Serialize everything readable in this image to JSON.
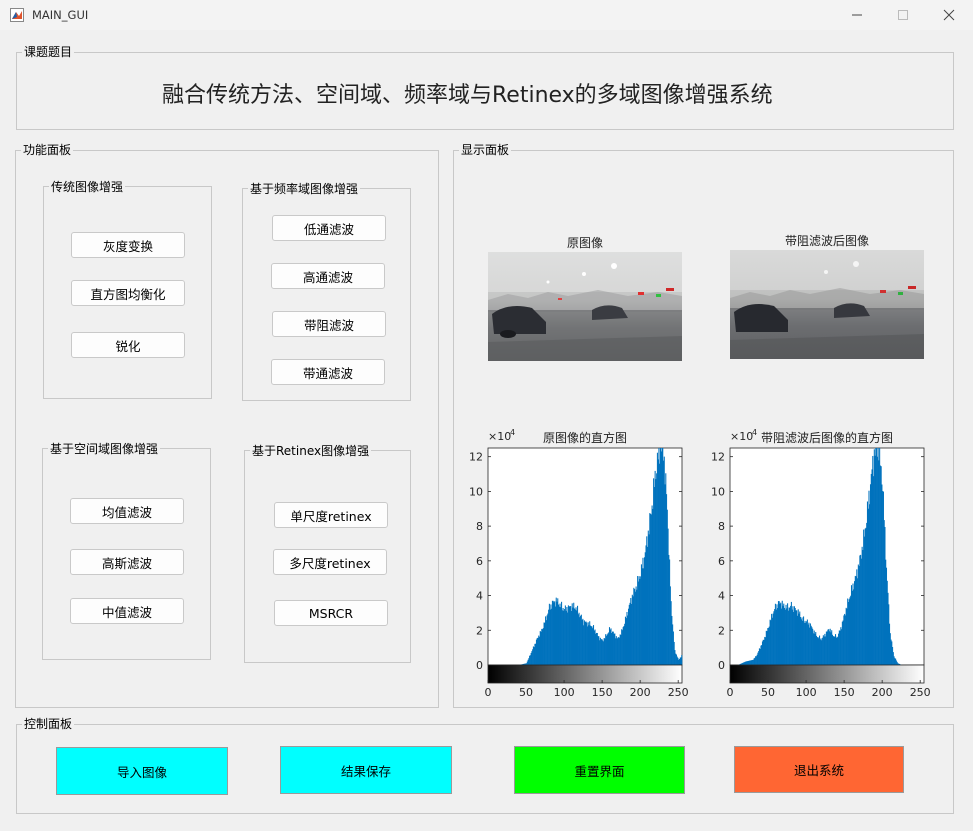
{
  "window": {
    "title": "MAIN_GUI"
  },
  "topic_panel": {
    "label": "课题题目",
    "title": "融合传统方法、空间域、频率域与Retinex的多域图像增强系统"
  },
  "function_panel": {
    "label": "功能面板",
    "traditional": {
      "label": "传统图像增强",
      "buttons": [
        "灰度变换",
        "直方图均衡化",
        "锐化"
      ]
    },
    "frequency": {
      "label": "基于频率域图像增强",
      "buttons": [
        "低通滤波",
        "高通滤波",
        "带阻滤波",
        "带通滤波"
      ]
    },
    "spatial": {
      "label": "基于空间域图像增强",
      "buttons": [
        "均值滤波",
        "高斯滤波",
        "中值滤波"
      ]
    },
    "retinex": {
      "label": "基于Retinex图像增强",
      "buttons": [
        "单尺度retinex",
        "多尺度retinex",
        "MSRCR"
      ]
    }
  },
  "display_panel": {
    "label": "显示面板",
    "original_title": "原图像",
    "filtered_title": "带阻滤波后图像",
    "original_hist_title": "原图像的直方图",
    "filtered_hist_title": "带阻滤波后图像的直方图"
  },
  "control_panel": {
    "label": "控制面板",
    "buttons": [
      {
        "label": "导入图像",
        "color": "#00ffff"
      },
      {
        "label": "结果保存",
        "color": "#00ffff"
      },
      {
        "label": "重置界面",
        "color": "#00ff00"
      },
      {
        "label": "退出系统",
        "color": "#ff6633"
      }
    ]
  },
  "chart_data": [
    {
      "type": "bar",
      "title": "原图像的直方图",
      "xlabel": "",
      "ylabel": "",
      "y_multiplier": "×10^4",
      "xlim": [
        0,
        255
      ],
      "ylim": [
        0,
        12.5
      ],
      "x_ticks": [
        0,
        50,
        100,
        150,
        200,
        250
      ],
      "y_ticks": [
        0,
        2,
        4,
        6,
        8,
        10,
        12
      ],
      "bar_color": "#0072bd",
      "x": [
        0,
        10,
        20,
        30,
        35,
        40,
        45,
        50,
        55,
        60,
        65,
        70,
        75,
        80,
        85,
        90,
        95,
        100,
        105,
        110,
        115,
        120,
        125,
        130,
        135,
        140,
        145,
        150,
        155,
        160,
        165,
        170,
        175,
        180,
        185,
        190,
        195,
        200,
        205,
        210,
        215,
        220,
        225,
        230,
        235,
        240,
        245,
        250,
        255
      ],
      "values": [
        0,
        0,
        0,
        0,
        0,
        0,
        0.05,
        0.1,
        0.6,
        1.1,
        1.6,
        2.0,
        2.6,
        3.3,
        3.6,
        3.7,
        3.4,
        3.2,
        3.3,
        3.4,
        3.3,
        2.9,
        2.5,
        2.4,
        2.3,
        2.0,
        1.6,
        1.4,
        1.7,
        2.1,
        1.8,
        1.5,
        1.9,
        2.6,
        3.4,
        4.1,
        4.6,
        5.3,
        6.2,
        7.6,
        9.2,
        11.2,
        12.5,
        12.5,
        9.0,
        3.5,
        0.8,
        0.3,
        0.6
      ]
    },
    {
      "type": "bar",
      "title": "带阻滤波后图像的直方图",
      "xlabel": "",
      "ylabel": "",
      "y_multiplier": "×10^4",
      "xlim": [
        0,
        255
      ],
      "ylim": [
        0,
        12.5
      ],
      "x_ticks": [
        0,
        50,
        100,
        150,
        200,
        250
      ],
      "y_ticks": [
        0,
        2,
        4,
        6,
        8,
        10,
        12
      ],
      "bar_color": "#0072bd",
      "x": [
        0,
        10,
        20,
        30,
        35,
        40,
        45,
        50,
        55,
        60,
        65,
        70,
        75,
        80,
        85,
        90,
        95,
        100,
        105,
        110,
        115,
        120,
        125,
        130,
        135,
        140,
        145,
        150,
        155,
        160,
        165,
        170,
        175,
        180,
        185,
        190,
        195,
        200,
        205,
        210,
        215,
        220,
        225,
        230,
        235,
        240,
        245,
        250,
        255
      ],
      "values": [
        0,
        0,
        0.2,
        0.3,
        0.6,
        1.1,
        1.6,
        2.2,
        2.9,
        3.4,
        3.6,
        3.4,
        3.3,
        3.4,
        3.2,
        3.0,
        2.6,
        2.5,
        2.3,
        1.9,
        1.6,
        1.5,
        1.8,
        2.1,
        1.7,
        1.6,
        2.1,
        2.9,
        3.7,
        4.4,
        5.1,
        6.0,
        7.2,
        8.8,
        10.8,
        12.5,
        12.5,
        10.4,
        5.6,
        1.8,
        0.5,
        0.1,
        0,
        0,
        0,
        0,
        0,
        0,
        0
      ]
    }
  ]
}
